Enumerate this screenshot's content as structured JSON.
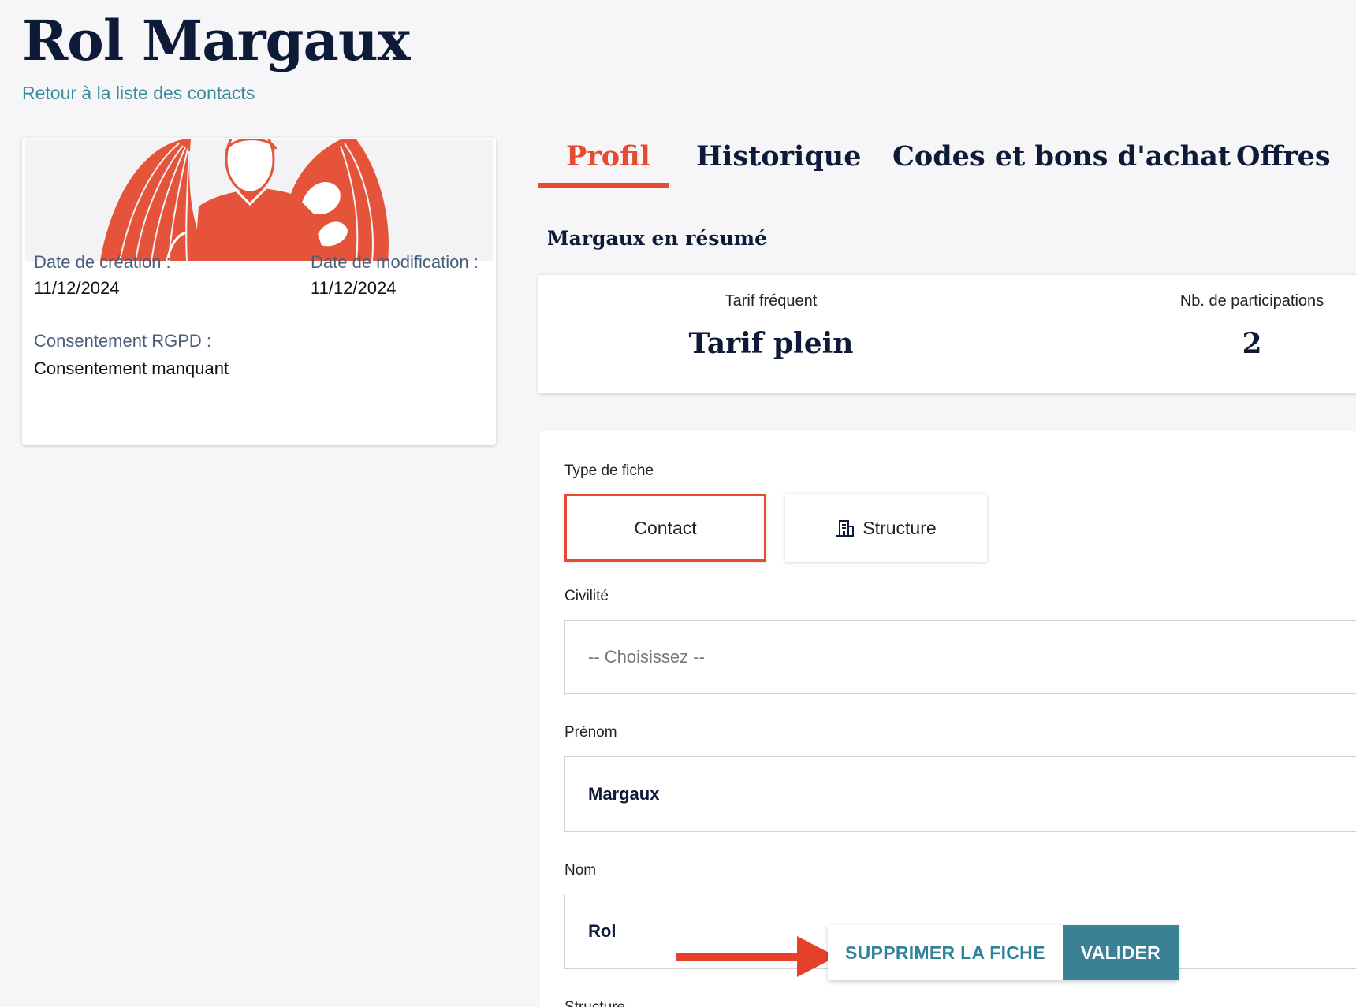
{
  "page": {
    "title": "Rol Margaux",
    "back_link": "Retour à la liste des contacts"
  },
  "profile_card": {
    "created_label": "Date de création :",
    "created_value": "11/12/2024",
    "modified_label": "Date de modification :",
    "modified_value": "11/12/2024",
    "consent_label": "Consentement RGPD :",
    "consent_value": "Consentement manquant"
  },
  "tabs": [
    {
      "label": "Profil",
      "active": true
    },
    {
      "label": "Historique",
      "active": false
    },
    {
      "label": "Codes et bons d'achat",
      "active": false
    },
    {
      "label": "Offres",
      "active": false
    }
  ],
  "summary": {
    "title": "Margaux en résumé",
    "stats": [
      {
        "label": "Tarif fréquent",
        "value": "Tarif plein"
      },
      {
        "label": "Nb. de participations",
        "value": "2"
      }
    ]
  },
  "form": {
    "type_label": "Type de fiche",
    "type_options": [
      {
        "label": "Contact",
        "selected": true
      },
      {
        "label": "Structure",
        "selected": false,
        "icon": "building-icon"
      }
    ],
    "civility_label": "Civilité",
    "civility_value": "-- Choisissez --",
    "firstname_label": "Prénom",
    "firstname_value": "Margaux",
    "lastname_label": "Nom",
    "lastname_value": "Rol",
    "structure_label": "Structure"
  },
  "actions": {
    "delete_label": "SUPPRIMER LA FICHE",
    "validate_label": "VALIDER"
  },
  "colors": {
    "accent": "#e54b31",
    "primary_dark": "#0d1a38",
    "teal": "#3a8196",
    "link": "#3a8a9c"
  }
}
